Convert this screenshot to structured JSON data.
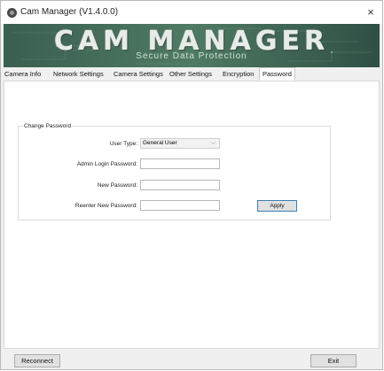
{
  "window": {
    "title": "Cam Manager (V1.4.0.0)",
    "close_label": "×"
  },
  "banner": {
    "logo_text": "CAM MANAGER",
    "subtitle": "Secure Data Protection"
  },
  "tabs": [
    {
      "label": "Camera Info",
      "active": false
    },
    {
      "label": "Network Settings",
      "active": false
    },
    {
      "label": "Camera Settings",
      "active": false
    },
    {
      "label": "Other Settings",
      "active": false
    },
    {
      "label": "Encryption",
      "active": false
    },
    {
      "label": "Password",
      "active": true
    }
  ],
  "change_password": {
    "group_title": "Change Password",
    "user_type_label": "User Type:",
    "user_type_value": "General User",
    "admin_password_label": "Admin Login Password:",
    "new_password_label": "New Password:",
    "reenter_password_label": "Reenter New Password:",
    "apply_label": "Apply"
  },
  "footer": {
    "reconnect_label": "Reconnect",
    "exit_label": "Exit"
  },
  "colors": {
    "banner_green": "#3f6a55",
    "active_button_border": "#3c7fb1"
  }
}
